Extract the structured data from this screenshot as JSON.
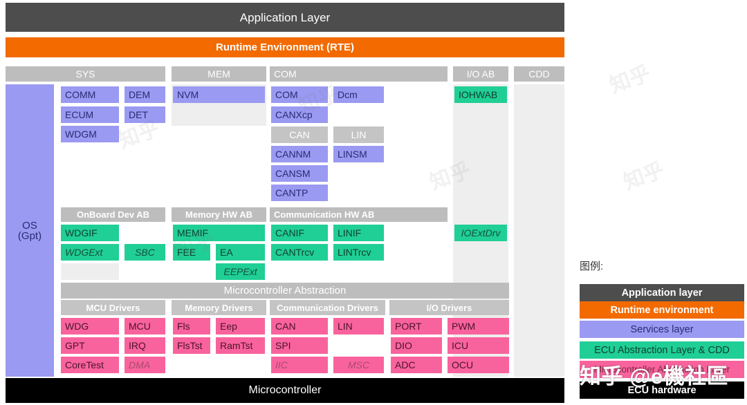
{
  "top": {
    "application_layer": "Application Layer",
    "rte": "Runtime Environment (RTE)"
  },
  "bottom": {
    "microcontroller": "Microcontroller"
  },
  "columns": {
    "sys": "SYS",
    "mem": "MEM",
    "com": "COM",
    "io_ab": "I/O AB",
    "cdd": "CDD"
  },
  "os": {
    "line1": "OS",
    "line2": "(Gpt)"
  },
  "services": {
    "sys": [
      {
        "label": "COMM",
        "italic": false
      },
      {
        "label": "DEM",
        "italic": false
      },
      {
        "label": "ECUM",
        "italic": false
      },
      {
        "label": "DET",
        "italic": false
      },
      {
        "label": "WDGM",
        "italic": false
      }
    ],
    "mem": [
      {
        "label": "NVM",
        "italic": false
      }
    ],
    "com": [
      {
        "label": "COM",
        "italic": false
      },
      {
        "label": "Dcm",
        "italic": false
      },
      {
        "label": "CANXcp",
        "italic": false
      },
      {
        "label": "CANNM",
        "italic": false
      },
      {
        "label": "LINSM",
        "italic": false
      },
      {
        "label": "CANSM",
        "italic": false
      },
      {
        "label": "CANTP",
        "italic": false
      }
    ],
    "com_bus_headers": [
      {
        "label": "CAN"
      },
      {
        "label": "LIN"
      }
    ]
  },
  "abstraction": {
    "onboard_dev_ab": "OnBoard Dev AB",
    "memory_hw_ab": "Memory HW AB",
    "communication_hw_ab": "Communication HW AB",
    "onboard_items": [
      {
        "label": "WDGIF",
        "italic": false
      },
      {
        "label": "WDGExt",
        "italic": true
      },
      {
        "label": "SBC",
        "italic": true
      }
    ],
    "memory_items": [
      {
        "label": "MEMIF",
        "italic": false
      },
      {
        "label": "FEE",
        "italic": false
      },
      {
        "label": "EA",
        "italic": false
      },
      {
        "label": "EEPExt",
        "italic": true
      }
    ],
    "communication_items": [
      {
        "label": "CANIF",
        "italic": false
      },
      {
        "label": "LINIF",
        "italic": false
      },
      {
        "label": "CANTrcv",
        "italic": false
      },
      {
        "label": "LINTrcv",
        "italic": false
      }
    ],
    "io_items": [
      {
        "label": "IOHWAB",
        "italic": false
      },
      {
        "label": "IOExtDrv",
        "italic": true
      }
    ]
  },
  "mcal": {
    "title": "Microcontroller Abstraction",
    "groups": [
      {
        "name": "MCU Drivers"
      },
      {
        "name": "Memory Drivers"
      },
      {
        "name": "Communication Drivers"
      },
      {
        "name": "I/O Drivers"
      }
    ],
    "mcu_drivers": [
      {
        "label": "WDG",
        "italic": false
      },
      {
        "label": "MCU",
        "italic": false
      },
      {
        "label": "GPT",
        "italic": false
      },
      {
        "label": "IRQ",
        "italic": false
      },
      {
        "label": "CoreTest",
        "italic": false
      },
      {
        "label": "DMA",
        "italic": true
      }
    ],
    "memory_drivers": [
      {
        "label": "Fls",
        "italic": false
      },
      {
        "label": "Eep",
        "italic": false
      },
      {
        "label": "FlsTst",
        "italic": false
      },
      {
        "label": "RamTst",
        "italic": false
      }
    ],
    "communication_drivers": [
      {
        "label": "CAN",
        "italic": false
      },
      {
        "label": "LIN",
        "italic": false
      },
      {
        "label": "SPI",
        "italic": false
      },
      {
        "label": "IIC",
        "italic": true
      },
      {
        "label": "MSC",
        "italic": true
      }
    ],
    "io_drivers": [
      {
        "label": "PORT",
        "italic": false
      },
      {
        "label": "PWM",
        "italic": false
      },
      {
        "label": "DIO",
        "italic": false
      },
      {
        "label": "ICU",
        "italic": false
      },
      {
        "label": "ADC",
        "italic": false
      },
      {
        "label": "OCU",
        "italic": false
      }
    ]
  },
  "legend": {
    "title": "图例:",
    "rows": [
      {
        "label": "Application layer",
        "color": "#4d4d4d"
      },
      {
        "label": "Runtime environment",
        "color": "#f26a00"
      },
      {
        "label": "Services layer",
        "color": "#9a9af2"
      },
      {
        "label": "ECU Abstraction Layer & CDD",
        "color": "#20cf95"
      },
      {
        "label": "Microcontroller Abstraction Layer",
        "color": "#f9639d"
      },
      {
        "label": "ECU hardware",
        "color": "#000000"
      }
    ]
  },
  "watermark": {
    "text": "知乎 @e機社區"
  },
  "colors": {
    "application": "#4d4d4d",
    "rte": "#f26a00",
    "services": "#9a9af2",
    "ecu_abstraction": "#20cf95",
    "mcal": "#f9639d",
    "hardware": "#000000",
    "group_header": "#bdbdbd",
    "panel": "#eeeeee"
  }
}
